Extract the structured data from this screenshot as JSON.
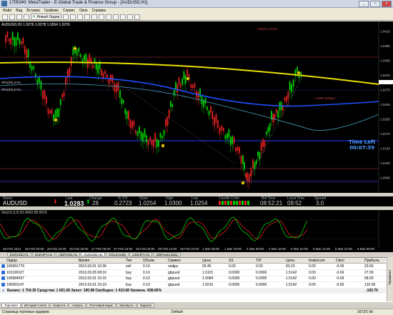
{
  "window": {
    "title": "1705340: MetaTrader - E-Global Trade & Finance Group - [AUDUSD,H1]",
    "min": "_",
    "max": "□",
    "close": "x"
  },
  "menu": [
    "Файл",
    "Вид",
    "Вставка",
    "Графики",
    "Сервис",
    "Окно",
    "Справка"
  ],
  "toolbar": {
    "new_order": "Новый Ордер"
  },
  "chart": {
    "symbol_label": "AUDUSD,H1 1.0276 1.0278 1.0264 1.0276",
    "line_labels": [
      "#R1(20),3 Nz...",
      "#R1(20),5 Nz...",
      "Flat(2) 1.0276",
      "1.0280 (Major)"
    ],
    "time_left_label": "Time Left",
    "time_left_value": "00:07:39",
    "price_ticks": [
      "1.0415",
      "1.0380",
      "1.0345",
      "1.0310",
      "1.0275",
      "1.0240",
      "1.0205",
      "1.0170",
      "1.0135",
      "1.0100",
      "1.0065"
    ]
  },
  "infobar": {
    "headers": [
      "Name",
      "Last",
      "Change",
      "% CH",
      "Open",
      "High",
      "Low",
      "Candle Color",
      "Bid Time",
      "Local Time",
      "Spread"
    ],
    "values": [
      "AUDUSD",
      "1.0283",
      "28",
      "0.2723",
      "1.0254",
      "1.0300",
      "1.0254",
      "",
      "08:52:21",
      "09:52",
      "3.0"
    ]
  },
  "stoch": {
    "title": "Sto(10,3,3) 81.8403 85.9519"
  },
  "dates": [
    "26 Feb 2013",
    "26 Feb 00:00",
    "26 Feb 10:00",
    "26 Feb 20:00",
    "27 Feb 06:00",
    "27 Feb 16:00",
    "28 Feb 02:00",
    "28 Feb 12:00",
    "28 Feb 22:00",
    "1 Mar 08:00",
    "1 Mar 18:00",
    "4 Mar 06:00",
    "4 Mar 16:00",
    "5 Mar 02:00",
    "5 Mar 12:00",
    "5 Mar 22:00",
    "6 Mar 08:00"
  ],
  "chart_tabs": [
    "EURUSD,H1",
    "EURJPY,H1",
    "GBPUSD,H1",
    "AUDUSD,H1",
    "GOLD,Daily",
    "USDJPY,H1",
    "GBPUSD,Daily"
  ],
  "active_chart_tab": 3,
  "terminal": {
    "columns": [
      "Ордер",
      "Время",
      "Тип",
      "Объём",
      "Символ",
      "Цена",
      "S/L",
      "T/P",
      "Цена",
      "Комиссия",
      "Своп",
      "Прибыль"
    ],
    "rows": [
      [
        "100991776",
        "2013.03.01 16:36",
        "sell",
        "0.10",
        "usdjpy",
        "93.45",
        "0.00",
        "0.00",
        "93.23",
        "0.00",
        "-0.09",
        "23.60"
      ],
      [
        "101100107",
        "2013.03.05 08:10",
        "buy",
        "0.10",
        "gbpusd",
        "1.5115",
        "0.0000",
        "0.0000",
        "1.5142",
        "0.00",
        "-0.69",
        "27.00"
      ],
      [
        "100984597",
        "2013.03.01 15:15",
        "buy",
        "0.10",
        "gbpusd",
        "1.5084",
        "0.0000",
        "0.0000",
        "1.5142",
        "0.00",
        "-0.69",
        "58.00"
      ],
      [
        "100991147",
        "2013.03.01 15:19",
        "buy",
        "0.10",
        "gbpusd",
        "1.5010",
        "0.0000",
        "0.0000",
        "1.5142",
        "0.00",
        "-0.69",
        "132.00"
      ]
    ],
    "balance_line": "Баланс: 1 704.35  Средства: 1 601.66  Залог: 190.98  Свободно: 1 410.68  Уровень: 838.66%",
    "balance_total": "-102.70",
    "side_label": "Терминал"
  },
  "terminal_tabs": [
    "Торговля",
    "История Счета",
    "Новости",
    "Алерты",
    "Почтовый ящик",
    "Эксперты",
    "Журнал"
  ],
  "active_terminal_tab": 0,
  "status": {
    "left": "Страница торговых ордеров",
    "mid": "Default",
    "right": "1672/1 kb"
  },
  "colors": {
    "bull": "#00d000",
    "bear": "#e02020",
    "ma_yellow": "#e8e000",
    "ma_blue": "#2050ff",
    "accent": "#4f9cff"
  }
}
